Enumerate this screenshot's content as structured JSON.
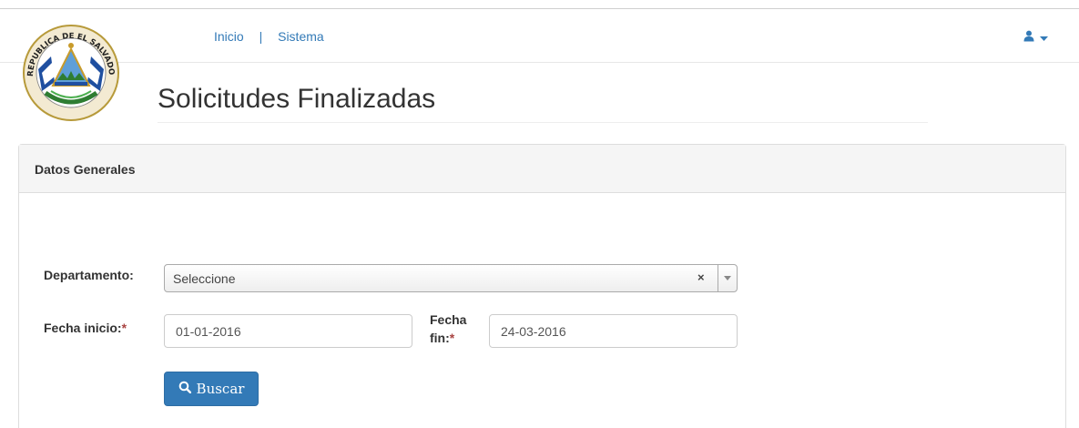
{
  "navbar": {
    "links": [
      "Inicio",
      "Sistema"
    ],
    "separator": "|",
    "user_icon": "user-icon",
    "caret_icon": "caret-down-icon"
  },
  "header": {
    "seal_icon": "el-salvador-coat-of-arms",
    "seal_text": "REPUBLICA DE EL SALVADOR EN LA AMERICA CENTRAL",
    "title": "Solicitudes Finalizadas"
  },
  "panel": {
    "heading": "Datos Generales"
  },
  "form": {
    "departamento_label": "Departamento:",
    "departamento_value": "Seleccione",
    "clear_symbol": "×",
    "fecha_inicio_label": "Fecha inicio:",
    "fecha_inicio_value": "01-01-2016",
    "fecha_fin_label_line1": "Fecha",
    "fecha_fin_label_line2": "fin:",
    "fecha_fin_value": "24-03-2016",
    "required_mark": "*",
    "search_button": "Buscar",
    "search_icon": "search-icon"
  },
  "colors": {
    "primary": "#337ab7",
    "required": "#a94442",
    "panel_heading_bg": "#f5f5f5"
  }
}
